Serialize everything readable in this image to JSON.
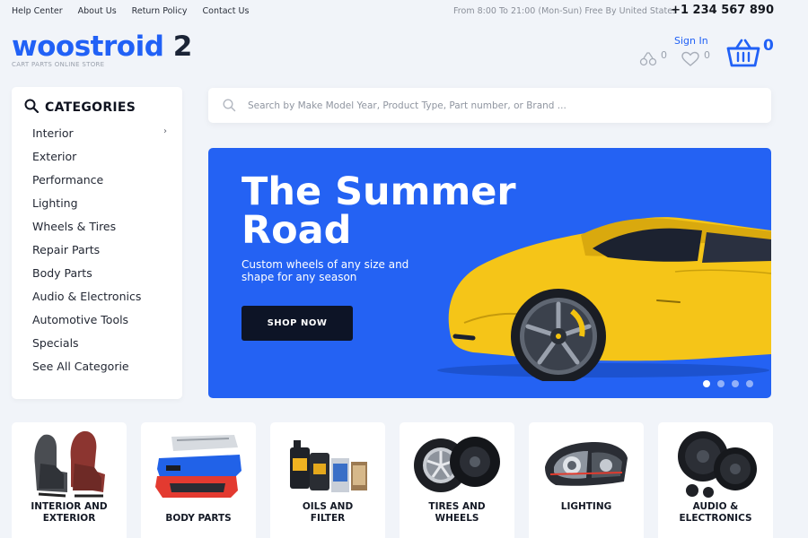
{
  "topbar": {
    "links": [
      "Help Center",
      "About Us",
      "Return Policy",
      "Contact Us"
    ],
    "hours": "From 8:00 To 21:00 (Mon-Sun) Free By United States",
    "phone": "+1 234 567 890"
  },
  "logo": {
    "word": "woostroid",
    "number": "2",
    "tagline": "CART PARTS ONLINE STORE"
  },
  "header": {
    "signin": "Sign In",
    "compare_count": "0",
    "wishlist_count": "0",
    "cart_count": "0",
    "icons": [
      "compare-icon",
      "heart-icon",
      "basket-icon"
    ]
  },
  "categories": {
    "title": "CATEGORIES",
    "items": [
      {
        "label": "Interior",
        "has_submenu": true
      },
      {
        "label": "Exterior"
      },
      {
        "label": "Performance"
      },
      {
        "label": "Lighting"
      },
      {
        "label": "Wheels & Tires"
      },
      {
        "label": "Repair Parts"
      },
      {
        "label": "Body Parts"
      },
      {
        "label": "Audio & Electronics"
      },
      {
        "label": "Automotive Tools"
      },
      {
        "label": "Specials"
      },
      {
        "label": "See All Categorie"
      }
    ]
  },
  "search": {
    "placeholder": "Search by Make Model Year, Product Type, Part number, or Brand ..."
  },
  "hero": {
    "title": "The Summer Road",
    "subtitle": "Custom wheels of any size and shape for any season",
    "button": "SHOP NOW",
    "slides": 4,
    "active_slide": 1
  },
  "tiles": [
    {
      "line1": "INTERIOR AND",
      "line2": "EXTERIOR"
    },
    {
      "line1": "",
      "line2": "BODY PARTS"
    },
    {
      "line1": "OILS AND",
      "line2": "FILTER"
    },
    {
      "line1": "TIRES AND",
      "line2": "WHEELS"
    },
    {
      "line1": "LIGHTING",
      "line2": ""
    },
    {
      "line1": "AUDIO &",
      "line2": "ELECTRONICS"
    }
  ],
  "colors": {
    "accent": "#2161f6",
    "hero_bg": "#2462f3",
    "button_dark": "#0d1426",
    "car": "#f5c518"
  }
}
